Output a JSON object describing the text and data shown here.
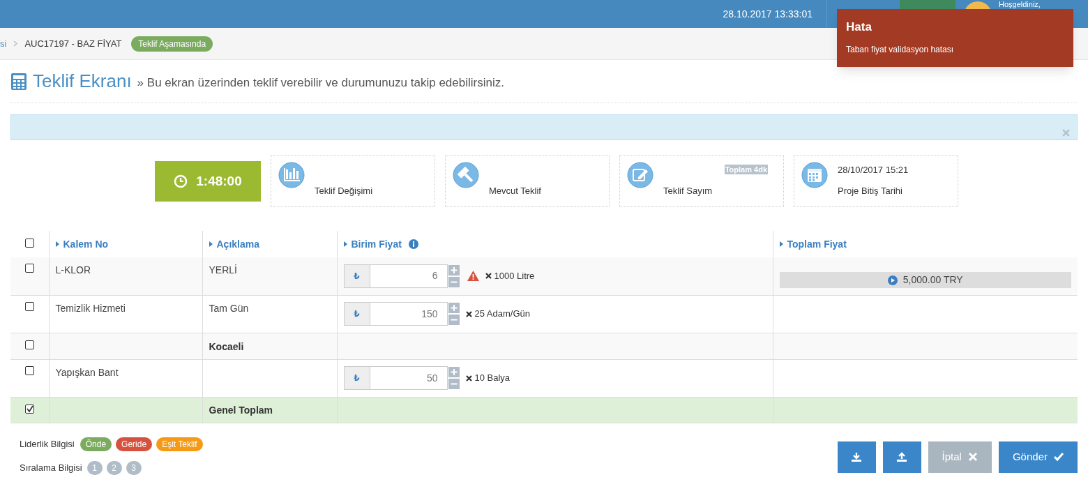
{
  "header": {
    "datetime": "28.10.2017 13:33:01",
    "greeting": "Hoşgeldiniz,"
  },
  "toast": {
    "title": "Hata",
    "message": "Taban fiyat validasyon hatası"
  },
  "breadcrumb": {
    "items": [
      "si",
      "AUC17197 - BAZ FİYAT"
    ],
    "status_badge": "Teklif Aşamasında"
  },
  "page_title": {
    "title": "Teklif Ekranı",
    "subtitle": "» Bu ekran üzerinden teklif verebilir ve durumunuzu takip edebilirsiniz."
  },
  "timer": "1:48:00",
  "stats": [
    {
      "kind": "chart",
      "label": "Teklif Değişimi"
    },
    {
      "kind": "gavel",
      "label": "Mevcut Teklif"
    },
    {
      "kind": "edit",
      "label": "Teklif Sayım",
      "badge": "Toplam 4dk"
    },
    {
      "kind": "calendar",
      "label": "Proje Bitiş Tarihi",
      "value": "28/10/2017 15:21"
    }
  ],
  "table": {
    "select_all": {
      "checked": false
    },
    "columns": [
      {
        "label": "Kalem No",
        "info": false
      },
      {
        "label": "Açıklama",
        "info": false
      },
      {
        "label": "Birim Fiyat",
        "info": true
      },
      {
        "label": "Toplam Fiyat",
        "info": false
      }
    ],
    "rows": [
      {
        "kind": "item",
        "checked": false,
        "kalem_no": "L-KLOR",
        "aciklama": "YERLİ",
        "currency": "₺",
        "price": "6",
        "warning": true,
        "quantity": "1000 Litre",
        "total": "5,000.00 TRY"
      },
      {
        "kind": "item",
        "checked": false,
        "kalem_no": "Temizlik Hizmeti",
        "aciklama": "Tam Gün",
        "currency": "₺",
        "price": "150",
        "warning": false,
        "quantity": "25 Adam/Gün"
      },
      {
        "kind": "group",
        "checked": false,
        "aciklama": "Kocaeli"
      },
      {
        "kind": "item",
        "checked": false,
        "kalem_no": "Yapışkan Bant",
        "currency": "₺",
        "price": "50",
        "warning": false,
        "quantity": "10 Balya"
      },
      {
        "kind": "total",
        "checked": true,
        "aciklama": "Genel Toplam"
      }
    ]
  },
  "legend": {
    "leadership_label": "Liderlik Bilgisi",
    "leadership": [
      {
        "label": "Önde",
        "color": "#7bab5e"
      },
      {
        "label": "Geride",
        "color": "#d5533e"
      },
      {
        "label": "Eşit Teklif",
        "color": "#f49a17"
      }
    ],
    "ranking_label": "Sıralama Bilgisi",
    "ranking": [
      "1",
      "2",
      "3"
    ]
  },
  "buttons": [
    {
      "kind": "download",
      "disabled": false
    },
    {
      "kind": "upload",
      "disabled": false
    },
    {
      "kind": "cancel",
      "label": "İptal",
      "disabled": true
    },
    {
      "kind": "submit",
      "label": "Gönder",
      "disabled": false
    }
  ]
}
